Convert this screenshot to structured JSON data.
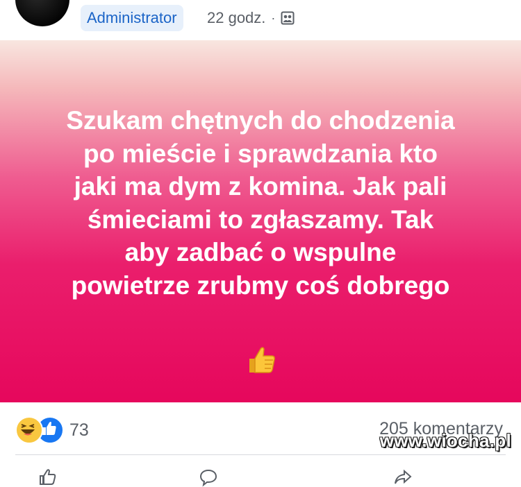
{
  "header": {
    "author_badge": "Administrator",
    "time": "22 godz.",
    "separator": "·",
    "audience_icon": "group-audience-icon"
  },
  "post": {
    "text": "Szukam chętnych do chodzenia\npo mieście i sprawdzania kto\njaki ma dym z komina. Jak pali\nśmieciami to zgłaszamy. Tak\naby zadbać o wspulne\npowietrze zrubmy coś dobrego",
    "emoji_icon": "thumbs-up-emoji-icon",
    "background_colors": [
      "#f8e6e0",
      "#ef5c90",
      "#e6075c"
    ]
  },
  "stats": {
    "reaction_icons": [
      "haha-reaction-icon",
      "like-reaction-icon"
    ],
    "reaction_count": "73",
    "comments": "205 komentarzy"
  },
  "watermark": "www.wiocha.pl",
  "colors": {
    "accent": "#1877f2",
    "badge_text": "#1b64c7",
    "badge_bg": "#e7f0fb",
    "muted_text": "#5a5f66"
  }
}
